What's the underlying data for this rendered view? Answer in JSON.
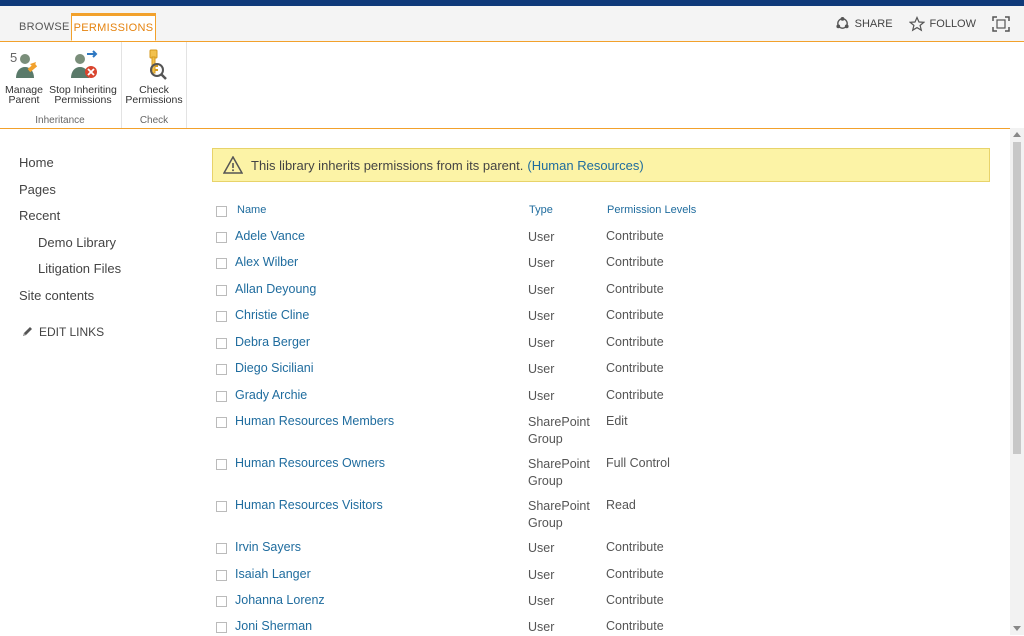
{
  "tabs": {
    "browse": "BROWSE",
    "permissions": "PERMISSIONS"
  },
  "actions": {
    "share": "SHARE",
    "follow": "FOLLOW"
  },
  "ribbon": {
    "inheritance": {
      "label": "Inheritance",
      "manage_parent": [
        "Manage",
        "Parent"
      ],
      "stop_inheriting": [
        "Stop Inheriting",
        "Permissions"
      ]
    },
    "check": {
      "label": "Check",
      "check_permissions": [
        "Check",
        "Permissions"
      ]
    }
  },
  "nav": {
    "home": "Home",
    "pages": "Pages",
    "recent": "Recent",
    "demo_library": "Demo Library",
    "litigation_files": "Litigation Files",
    "site_contents": "Site contents",
    "edit_links": "EDIT LINKS"
  },
  "notice": {
    "text": "This library inherits permissions from its parent.",
    "link": "(Human Resources)"
  },
  "table": {
    "headers": {
      "name": "Name",
      "type": "Type",
      "levels": "Permission Levels"
    },
    "rows": [
      {
        "name": "Adele Vance",
        "type": [
          "User"
        ],
        "level": "Contribute"
      },
      {
        "name": "Alex Wilber",
        "type": [
          "User"
        ],
        "level": "Contribute"
      },
      {
        "name": "Allan Deyoung",
        "type": [
          "User"
        ],
        "level": "Contribute"
      },
      {
        "name": "Christie Cline",
        "type": [
          "User"
        ],
        "level": "Contribute"
      },
      {
        "name": "Debra Berger",
        "type": [
          "User"
        ],
        "level": "Contribute"
      },
      {
        "name": "Diego Siciliani",
        "type": [
          "User"
        ],
        "level": "Contribute"
      },
      {
        "name": "Grady Archie",
        "type": [
          "User"
        ],
        "level": "Contribute"
      },
      {
        "name": "Human Resources Members",
        "type": [
          "SharePoint",
          "Group"
        ],
        "level": "Edit"
      },
      {
        "name": "Human Resources Owners",
        "type": [
          "SharePoint",
          "Group"
        ],
        "level": "Full Control"
      },
      {
        "name": "Human Resources Visitors",
        "type": [
          "SharePoint",
          "Group"
        ],
        "level": "Read"
      },
      {
        "name": "Irvin Sayers",
        "type": [
          "User"
        ],
        "level": "Contribute"
      },
      {
        "name": "Isaiah Langer",
        "type": [
          "User"
        ],
        "level": "Contribute"
      },
      {
        "name": "Johanna Lorenz",
        "type": [
          "User"
        ],
        "level": "Contribute"
      },
      {
        "name": "Joni Sherman",
        "type": [
          "User"
        ],
        "level": "Contribute"
      }
    ]
  },
  "colors": {
    "accent": "#f2a12c",
    "link": "#1f6c9e",
    "topbar": "#0f3a7a",
    "notice_bg": "#fcf3a6"
  }
}
